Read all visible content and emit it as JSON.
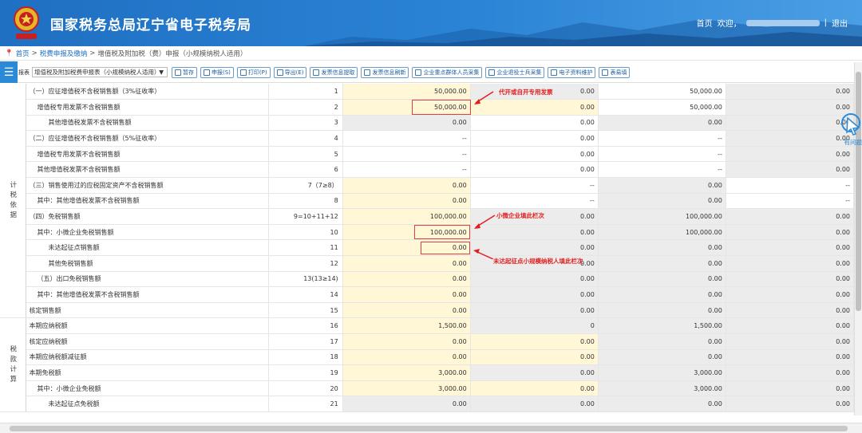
{
  "header": {
    "title": "国家税务总局辽宁省电子税务局",
    "home": "首页",
    "welcome": "欢迎，",
    "logout": "退出"
  },
  "breadcrumb": {
    "home": "首页",
    "level1": "税费申报及缴纳",
    "current": "增值税及附加税（费）申报（小规模纳税人适用）"
  },
  "toolbar": {
    "table_label": "报表",
    "table_select": "增值税及附加税费申报表（小规模纳税人适用）",
    "buttons": [
      "暂存",
      "申报(S)",
      "打印(P)",
      "导出(E)",
      "发票信息提取",
      "发票信息刷新",
      "企业重点群体人员采集",
      "企业退役士兵采集",
      "电子资料维护",
      "表易填"
    ]
  },
  "sections": {
    "basis": "计税依据",
    "tax": "税款计算"
  },
  "rows": [
    {
      "label": "（一）应征增值税不含税销售额（3%征收率）",
      "line": "1",
      "v": [
        "50,000.00",
        "0.00",
        "50,000.00",
        "0.00"
      ]
    },
    {
      "label": "增值税专用发票不含税销售额",
      "line": "2",
      "v": [
        "50,000.00",
        "0.00",
        "50,000.00",
        "0.00"
      ]
    },
    {
      "label": "其他增值税发票不含税销售额",
      "line": "3",
      "v": [
        "0.00",
        "0.00",
        "0.00",
        "0.00"
      ]
    },
    {
      "label": "（二）应征增值税不含税销售额（5%征收率）",
      "line": "4",
      "v": [
        "--",
        "0.00",
        "--",
        "0.00"
      ]
    },
    {
      "label": "增值税专用发票不含税销售额",
      "line": "5",
      "v": [
        "--",
        "0.00",
        "--",
        "0.00"
      ]
    },
    {
      "label": "其他增值税发票不含税销售额",
      "line": "6",
      "v": [
        "--",
        "0.00",
        "--",
        "0.00"
      ]
    },
    {
      "label": "（三）销售使用过的应税固定资产不含税销售额",
      "line": "7（7≥8）",
      "v": [
        "0.00",
        "--",
        "0.00",
        "--"
      ]
    },
    {
      "label": "其中：其他增值税发票不含税销售额",
      "line": "8",
      "v": [
        "0.00",
        "--",
        "0.00",
        "--"
      ]
    },
    {
      "label": "（四）免税销售额",
      "line": "9=10+11+12",
      "v": [
        "100,000.00",
        "0.00",
        "100,000.00",
        "0.00"
      ]
    },
    {
      "label": "其中：小微企业免税销售额",
      "line": "10",
      "v": [
        "100,000.00",
        "0.00",
        "100,000.00",
        "0.00"
      ]
    },
    {
      "label": "未达起征点销售额",
      "line": "11",
      "v": [
        "0.00",
        "0.00",
        "0.00",
        "0.00"
      ]
    },
    {
      "label": "其他免税销售额",
      "line": "12",
      "v": [
        "0.00",
        "0.00",
        "0.00",
        "0.00"
      ]
    },
    {
      "label": "（五）出口免税销售额",
      "line": "13(13≥14)",
      "v": [
        "0.00",
        "0.00",
        "0.00",
        "0.00"
      ]
    },
    {
      "label": "其中：其他增值税发票不含税销售额",
      "line": "14",
      "v": [
        "0.00",
        "0.00",
        "0.00",
        "0.00"
      ]
    },
    {
      "label": "核定销售额",
      "line": "15",
      "v": [
        "0.00",
        "0.00",
        "0.00",
        "0.00"
      ]
    },
    {
      "label": "本期应纳税额",
      "line": "16",
      "v": [
        "1,500.00",
        "0",
        "1,500.00",
        "0.00"
      ]
    },
    {
      "label": "核定应纳税额",
      "line": "17",
      "v": [
        "0.00",
        "0.00",
        "0.00",
        "0.00"
      ]
    },
    {
      "label": "本期应纳税额减征额",
      "line": "18",
      "v": [
        "0.00",
        "0.00",
        "0.00",
        "0.00"
      ]
    },
    {
      "label": "本期免税额",
      "line": "19",
      "v": [
        "3,000.00",
        "0.00",
        "3,000.00",
        "0.00"
      ]
    },
    {
      "label": "其中：小微企业免税额",
      "line": "20",
      "v": [
        "3,000.00",
        "0.00",
        "3,000.00",
        "0.00"
      ]
    },
    {
      "label": "未达起征点免税额",
      "line": "21",
      "v": [
        "0.00",
        "0.00",
        "0.00",
        "0.00"
      ]
    }
  ],
  "annotations": {
    "a1": "代开或自开专用发票",
    "a2": "小微企业填此栏次",
    "a3": "未达起征点小规模纳税人填此栏次"
  },
  "help": "有问题"
}
